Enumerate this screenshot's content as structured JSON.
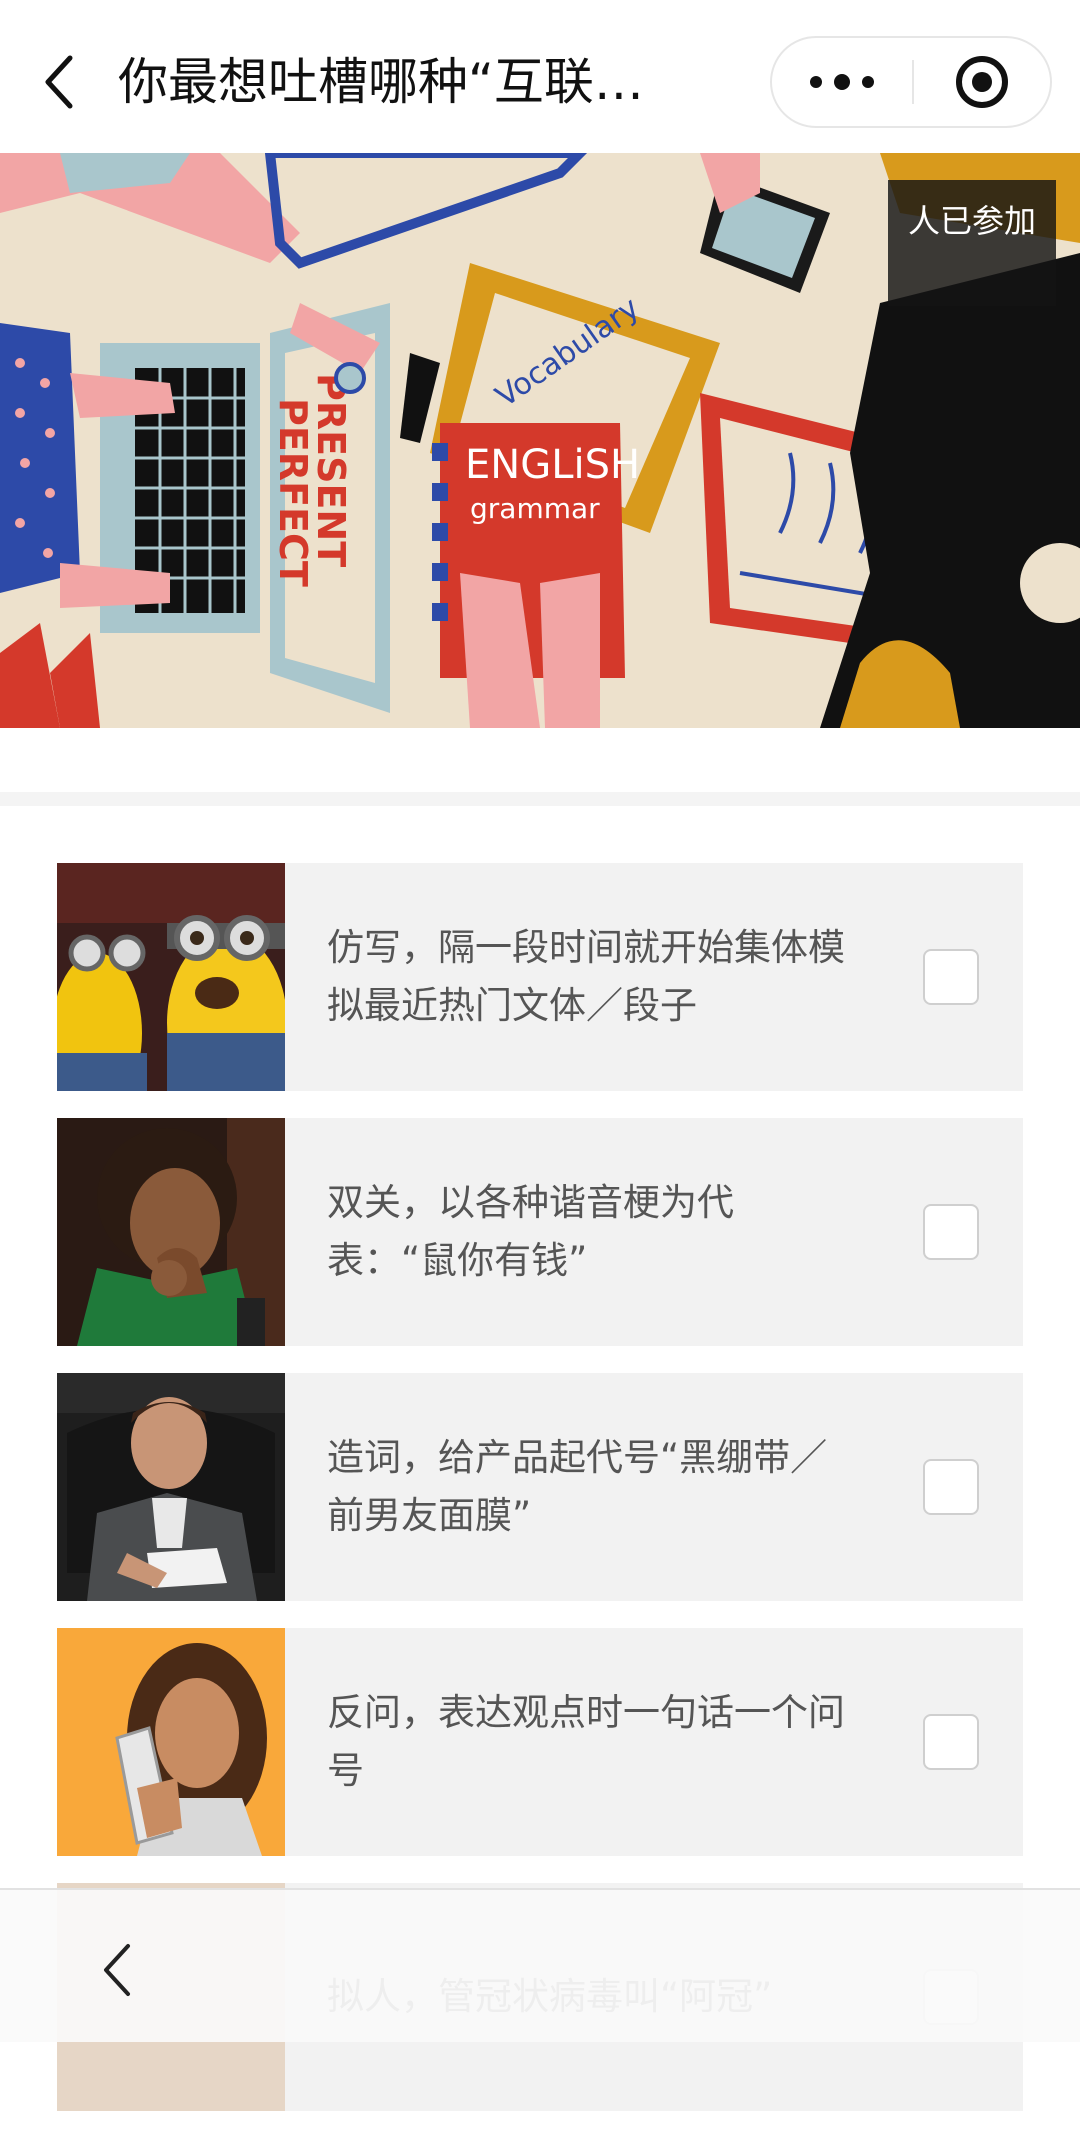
{
  "header": {
    "title": "你最想吐槽哪种“互联网…",
    "back_icon": "chevron-left-icon",
    "more_icon": "more-dots-icon",
    "close_icon": "target-circle-icon"
  },
  "banner": {
    "participants_text": "人已参加",
    "image_description_icon": "illustration-image"
  },
  "options": [
    {
      "label": "仿写，隔一段时间就开始集体模拟最近热门文体／段子",
      "checked": false
    },
    {
      "label": "双关，以各种谐音梗为代表：“鼠你有钱”",
      "checked": false
    },
    {
      "label": "造词，给产品起代号“黑绷带／前男友面膜”",
      "checked": false
    },
    {
      "label": "反问，表达观点时一句话一个问号",
      "checked": false
    },
    {
      "label": "拟人，管冠状病毒叫“阿冠”",
      "checked": false
    }
  ],
  "bottom_bar": {
    "back_icon": "chevron-left-icon"
  },
  "colors": {
    "option_bg": "#f2f2f2",
    "text": "#555555",
    "badge_bg": "#141414"
  }
}
